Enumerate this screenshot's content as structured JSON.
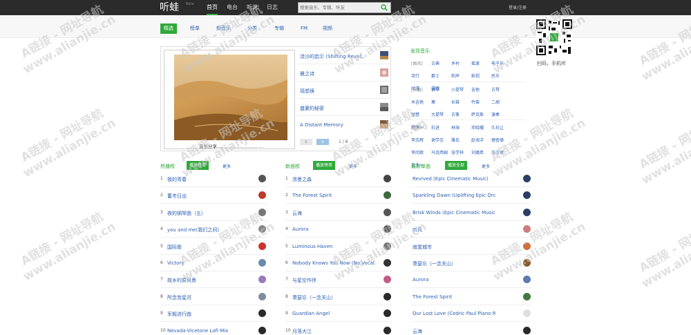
{
  "topbar": {
    "logo": "听蛙",
    "beta": "Beta",
    "nav": [
      "首页",
      "电台",
      "听说",
      "日志"
    ],
    "search_placeholder": "搜索音乐、专辑、听友",
    "login": "登录/注册"
  },
  "subnav": [
    "精选",
    "榜单",
    "频音乐",
    "分类",
    "专辑",
    "FM",
    "视频"
  ],
  "qr": {
    "caption": "扫码，手机听"
  },
  "carousel": {
    "caption": "音乐分享……………………… …",
    "items": [
      "流沙的启示 (Shifting Revel...",
      "晨之诗",
      "瑶想境",
      "盛夏的秘密",
      "A Distant Memory"
    ],
    "page": "1 / 8",
    "prev": "∧",
    "next": "∨"
  },
  "discover": {
    "title": "发现音乐",
    "groups": [
      {
        "head": "[曲风]",
        "tags": [
          "古典",
          "乡村",
          "摇滚",
          "电子乐",
          "流行",
          "爵士",
          "和声",
          "影视",
          "民乐",
          "动漫",
          "游戏"
        ]
      },
      {
        "head": "[乐器]",
        "tags": [
          "钢琴",
          "小提琴",
          "吉他",
          "古琴",
          "木吉他",
          "萧",
          "长笛",
          "竹笛",
          "二胡",
          "琵琶",
          "大提琴",
          "古筝",
          "萨克斯",
          "演奏",
          "更多>"
        ]
      },
      {
        "head": "[音乐人]",
        "tags": [
          "石进",
          "林海",
          "邓晓耀",
          "久石让",
          "李志辉",
          "谢学志",
          "雅氏",
          "赵海洋",
          "理查德",
          "李闰珉",
          "马克西姆",
          "张学祥",
          "刘璐希",
          "张次律",
          "更多>"
        ]
      }
    ]
  },
  "columns": [
    {
      "title": "热播榜",
      "button": "播放榜单",
      "more": "更多",
      "avatar_colors": [
        "#555",
        "#c0392b",
        "#777",
        "#888",
        "#d32f2f",
        "#6a8bb0",
        "#9a7ab8",
        "#7e8e9e",
        "#2a2a2a",
        "#2a2a2a"
      ],
      "rows": [
        "我的青春",
        "蓄市日出",
        "夜的钢琴曲（五）",
        "you and me(我们之间)",
        "国际歌",
        "Victory",
        "故乡的原风景",
        "所念皆星河",
        "军舰进行曲",
        "Nevada-Vicetone Lofi Mix"
      ]
    },
    {
      "title": "新曲榜",
      "button": "播放榜单",
      "more": "更多",
      "avatar_colors": [
        "#444",
        "#3a6a3a",
        "#555",
        "#555",
        "#777",
        "#333",
        "#c25a8a",
        "#2a2a2a",
        "#2a2a2a",
        "#2a2a2a"
      ],
      "rows": [
        "浓墨之森",
        "The Forest Spirit",
        "云海",
        "Aurora",
        "Luminous Haven",
        "Nobody Knows You Now (No Vocal)",
        "与星空作伴",
        "萧瑟忘（一念关山）",
        "Guardian Angel",
        "月落大江"
      ]
    },
    {
      "title": "最新单曲",
      "button": "播放全部",
      "more": "更多",
      "avatar_colors": [
        "#2b3f66",
        "#2b3f66",
        "#2b3f66",
        "#d07c7c",
        "#d26f3a",
        "#8b5a2b",
        "#5a7ab0",
        "#3f7a3f",
        "#e0e0e0",
        "#2a2a2a"
      ],
      "rows": [
        "Revived (Epic Cinematic Music)",
        "Sparkling Dawn (Uplifting Epic Orchest...",
        "Brisk Winds (Epic Cinematic Music)",
        "听风",
        "寂寞城市",
        "萧瑟忘（一念关山）",
        "Aurora",
        "The Forest Spirit",
        "Our Lost Love (Cedric Paul Piano Remix)",
        "云海"
      ]
    }
  ],
  "watermark": {
    "line1": "A链接 - 网址导航",
    "line2": "www.alianjie.cn"
  },
  "colors": {
    "topbar": "#2b2b2b",
    "accent": "#2fa93a",
    "link": "#2a5db0",
    "pager": "#9dc3e6"
  }
}
